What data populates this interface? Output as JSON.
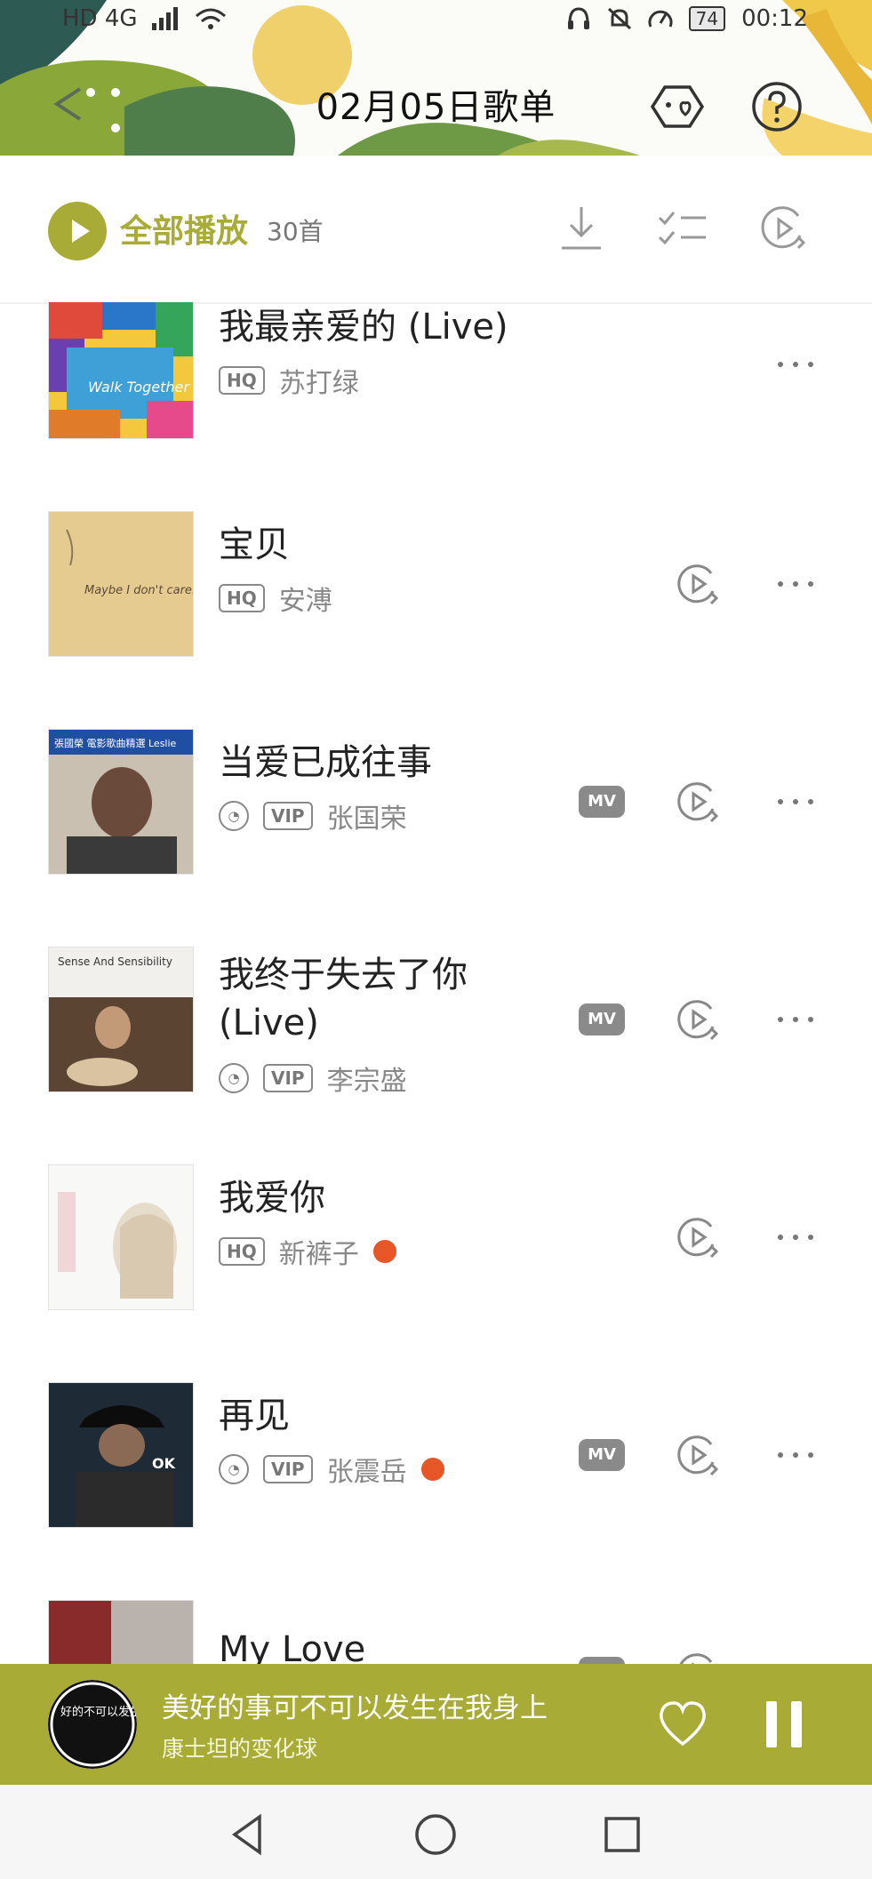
{
  "status_bar": {
    "left_text": "HD 4G",
    "battery": "74",
    "time": "00:12"
  },
  "header": {
    "title": "02月05日歌单"
  },
  "play_all": {
    "label": "全部播放",
    "count": "30首"
  },
  "songs": [
    {
      "title": "我最亲爱的 (Live)",
      "quality": "HQ",
      "artist": "苏打绿",
      "has_mv": false,
      "has_play": false,
      "hot": false,
      "cover_text": "Walk Together Live"
    },
    {
      "title": "宝贝",
      "quality": "HQ",
      "artist": "安溥",
      "has_mv": false,
      "has_play": true,
      "hot": false,
      "cover_text": "Maybe I don't care."
    },
    {
      "title": "当爱已成往事",
      "quality": "VIP",
      "artist": "张国荣",
      "has_mv": true,
      "has_play": true,
      "hot": false,
      "cover_text": "張國榮 電影歌曲精選 Leslie"
    },
    {
      "title_line1": "我终于失去了你",
      "title_line2": "(Live)",
      "quality": "VIP",
      "artist": "李宗盛",
      "has_mv": true,
      "has_play": true,
      "hot": false,
      "cover_text": "Sense And Sensibility"
    },
    {
      "title": "我爱你",
      "quality": "HQ",
      "artist": "新裤子",
      "has_mv": false,
      "has_play": true,
      "hot": true
    },
    {
      "title": "再见",
      "quality": "VIP",
      "artist": "张震岳",
      "has_mv": true,
      "has_play": true,
      "hot": true,
      "cover_text": "OK"
    },
    {
      "title": "My Love",
      "has_mv": true,
      "has_play": true
    }
  ],
  "labels": {
    "hq": "HQ",
    "vip": "VIP",
    "mv": "MV",
    "more": "···"
  },
  "mini_player": {
    "title": "美好的事可不可以发生在我身上",
    "artist": "康士坦的变化球",
    "disc_text": "好的不可以发生在我身上"
  },
  "colors": {
    "accent": "#a8ac36",
    "hot": "#e65627",
    "badge_gray": "#8a8a8a"
  }
}
